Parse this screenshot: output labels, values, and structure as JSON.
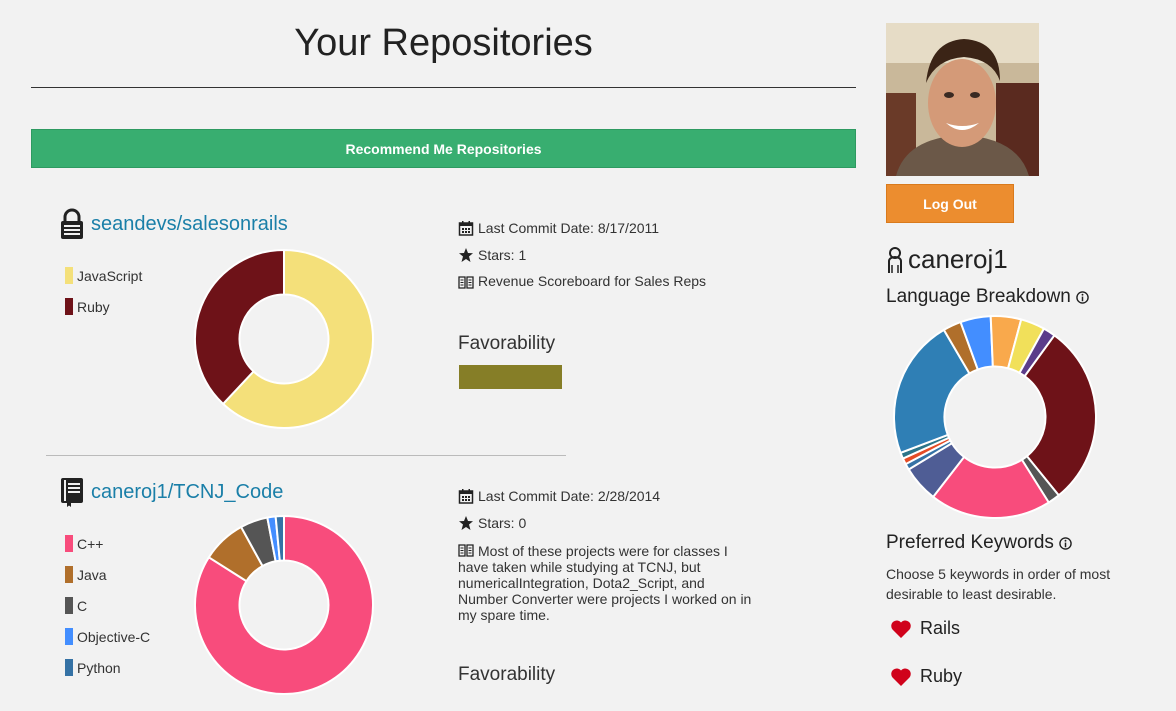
{
  "page": {
    "title": "Your Repositories"
  },
  "actions": {
    "recommend_label": "Recommend Me Repositories",
    "logout_label": "Log Out"
  },
  "repos": [
    {
      "name": "seandevs/salesonrails",
      "visibility_icon": "lock-icon",
      "languages": [
        {
          "name": "JavaScript",
          "color": "#f4e07a",
          "value": 62
        },
        {
          "name": "Ruby",
          "color": "#6e1218",
          "value": 38
        }
      ],
      "last_commit": "Last Commit Date: 8/17/2011",
      "stars": "Stars: 1",
      "description": "Revenue Scoreboard for Sales Reps",
      "favorability_label": "Favorability",
      "favorability_color": "#867e27"
    },
    {
      "name": "caneroj1/TCNJ_Code",
      "visibility_icon": "book-icon",
      "languages": [
        {
          "name": "C++",
          "color": "#f84c7c",
          "value": 84
        },
        {
          "name": "Java",
          "color": "#b06f2b",
          "value": 8
        },
        {
          "name": "C",
          "color": "#555555",
          "value": 5
        },
        {
          "name": "Objective-C",
          "color": "#438eff",
          "value": 1.5
        },
        {
          "name": "Python",
          "color": "#3572a5",
          "value": 1.5
        }
      ],
      "last_commit": "Last Commit Date: 2/28/2014",
      "stars": "Stars: 0",
      "description": "Most of these projects were for classes I have taken while studying at TCNJ, but numericalIntegration, Dota2_Script, and Number Converter were projects I worked on in my spare time.",
      "favorability_label": "Favorability"
    }
  ],
  "profile": {
    "username": "caneroj1",
    "language_breakdown_title": "Language Breakdown",
    "language_breakdown": [
      {
        "color": "#6e1218",
        "value": 30
      },
      {
        "color": "#555555",
        "value": 2
      },
      {
        "color": "#f84c7c",
        "value": 20
      },
      {
        "color": "#4f5d95",
        "value": 6
      },
      {
        "color": "#3572a5",
        "value": 1
      },
      {
        "color": "#e34c26",
        "value": 1
      },
      {
        "color": "#2b7489",
        "value": 1
      },
      {
        "color": "#2f7fb5",
        "value": 23
      },
      {
        "color": "#b06f2b",
        "value": 3
      },
      {
        "color": "#438eff",
        "value": 5
      },
      {
        "color": "#f9a94c",
        "value": 5
      },
      {
        "color": "#f1e05a",
        "value": 4
      },
      {
        "color": "#5b3c8a",
        "value": 2
      }
    ],
    "keywords_title": "Preferred Keywords",
    "keywords_desc": "Choose 5 keywords in order of most desirable to least desirable.",
    "keywords": [
      "Rails",
      "Ruby"
    ]
  }
}
